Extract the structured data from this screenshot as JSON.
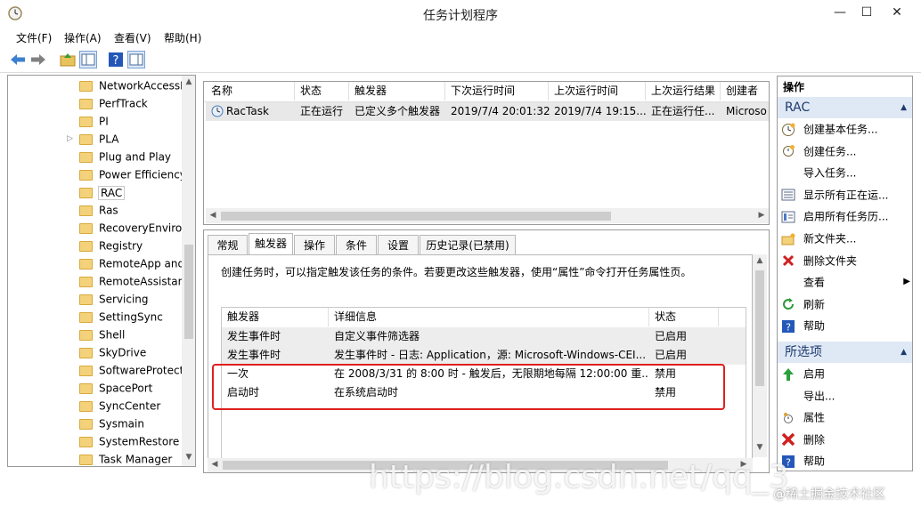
{
  "window": {
    "title": "任务计划程序",
    "minimize": "—",
    "maximize": "☐",
    "close": "✕"
  },
  "menu": [
    "文件(F)",
    "操作(A)",
    "查看(V)",
    "帮助(H)"
  ],
  "tree": [
    {
      "label": "NetworkAccessI"
    },
    {
      "label": "PerfTrack"
    },
    {
      "label": "PI"
    },
    {
      "label": "PLA",
      "expand": "▷"
    },
    {
      "label": "Plug and Play"
    },
    {
      "label": "Power Efficiency"
    },
    {
      "label": "RAC",
      "selected": true
    },
    {
      "label": "Ras"
    },
    {
      "label": "RecoveryEnviror"
    },
    {
      "label": "Registry"
    },
    {
      "label": "RemoteApp and"
    },
    {
      "label": "RemoteAssistan"
    },
    {
      "label": "Servicing"
    },
    {
      "label": "SettingSync"
    },
    {
      "label": "Shell"
    },
    {
      "label": "SkyDrive"
    },
    {
      "label": "SoftwareProtect"
    },
    {
      "label": "SpacePort"
    },
    {
      "label": "SyncCenter"
    },
    {
      "label": "Sysmain"
    },
    {
      "label": "SystemRestore"
    },
    {
      "label": "Task Manager"
    }
  ],
  "tasks": {
    "headers": [
      "名称",
      "状态",
      "触发器",
      "下次运行时间",
      "上次运行时间",
      "上次运行结果",
      "创建者"
    ],
    "rows": [
      [
        "RacTask",
        "正在运行",
        "已定义多个触发器",
        "2019/7/4 20:01:32",
        "2019/7/4 19:15...",
        "正在运行任...",
        "Microso"
      ]
    ]
  },
  "tabs": [
    "常规",
    "触发器",
    "操作",
    "条件",
    "设置",
    "历史记录(已禁用)"
  ],
  "active_tab": "触发器",
  "trigger_desc": "创建任务时，可以指定触发该任务的条件。若要更改这些触发器，使用“属性”命令打开任务属性页。",
  "triggers": {
    "headers": [
      "触发器",
      "详细信息",
      "状态"
    ],
    "rows": [
      [
        "发生事件时",
        "自定义事件筛选器",
        "已启用"
      ],
      [
        "发生事件时",
        "发生事件时 - 日志: Application，源: Microsoft-Windows-CEI...",
        "已启用"
      ],
      [
        "一次",
        "在 2008/3/31 的 8:00 时 - 触发后，无限期地每隔 12:00:00 重...",
        "禁用"
      ],
      [
        "启动时",
        "在系统启动时",
        "禁用"
      ]
    ],
    "highlight_color": "#e02020"
  },
  "actions": {
    "title": "操作",
    "section1": "RAC",
    "items1": [
      {
        "label": "创建基本任务...",
        "icon": "create-basic-task-icon"
      },
      {
        "label": "创建任务...",
        "icon": "create-task-icon"
      },
      {
        "label": "导入任务...",
        "icon": ""
      },
      {
        "label": "显示所有正在运...",
        "icon": "running-tasks-icon"
      },
      {
        "label": "启用所有任务历...",
        "icon": "history-icon"
      },
      {
        "label": "新文件夹...",
        "icon": "new-folder-icon"
      },
      {
        "label": "删除文件夹",
        "icon": "delete-folder-icon"
      },
      {
        "label": "查看",
        "icon": "",
        "submenu": "▶"
      },
      {
        "label": "刷新",
        "icon": "refresh-icon"
      },
      {
        "label": "帮助",
        "icon": "help-icon"
      }
    ],
    "section2": "所选项",
    "items2": [
      {
        "label": "启用",
        "icon": "enable-icon"
      },
      {
        "label": "导出...",
        "icon": ""
      },
      {
        "label": "属性",
        "icon": "properties-icon"
      },
      {
        "label": "删除",
        "icon": "delete-icon"
      },
      {
        "label": "帮助",
        "icon": "help-icon"
      }
    ]
  },
  "watermark": "https://blog.csdn.net/qq_3",
  "watermark2": "@稀土掘金技术社区"
}
